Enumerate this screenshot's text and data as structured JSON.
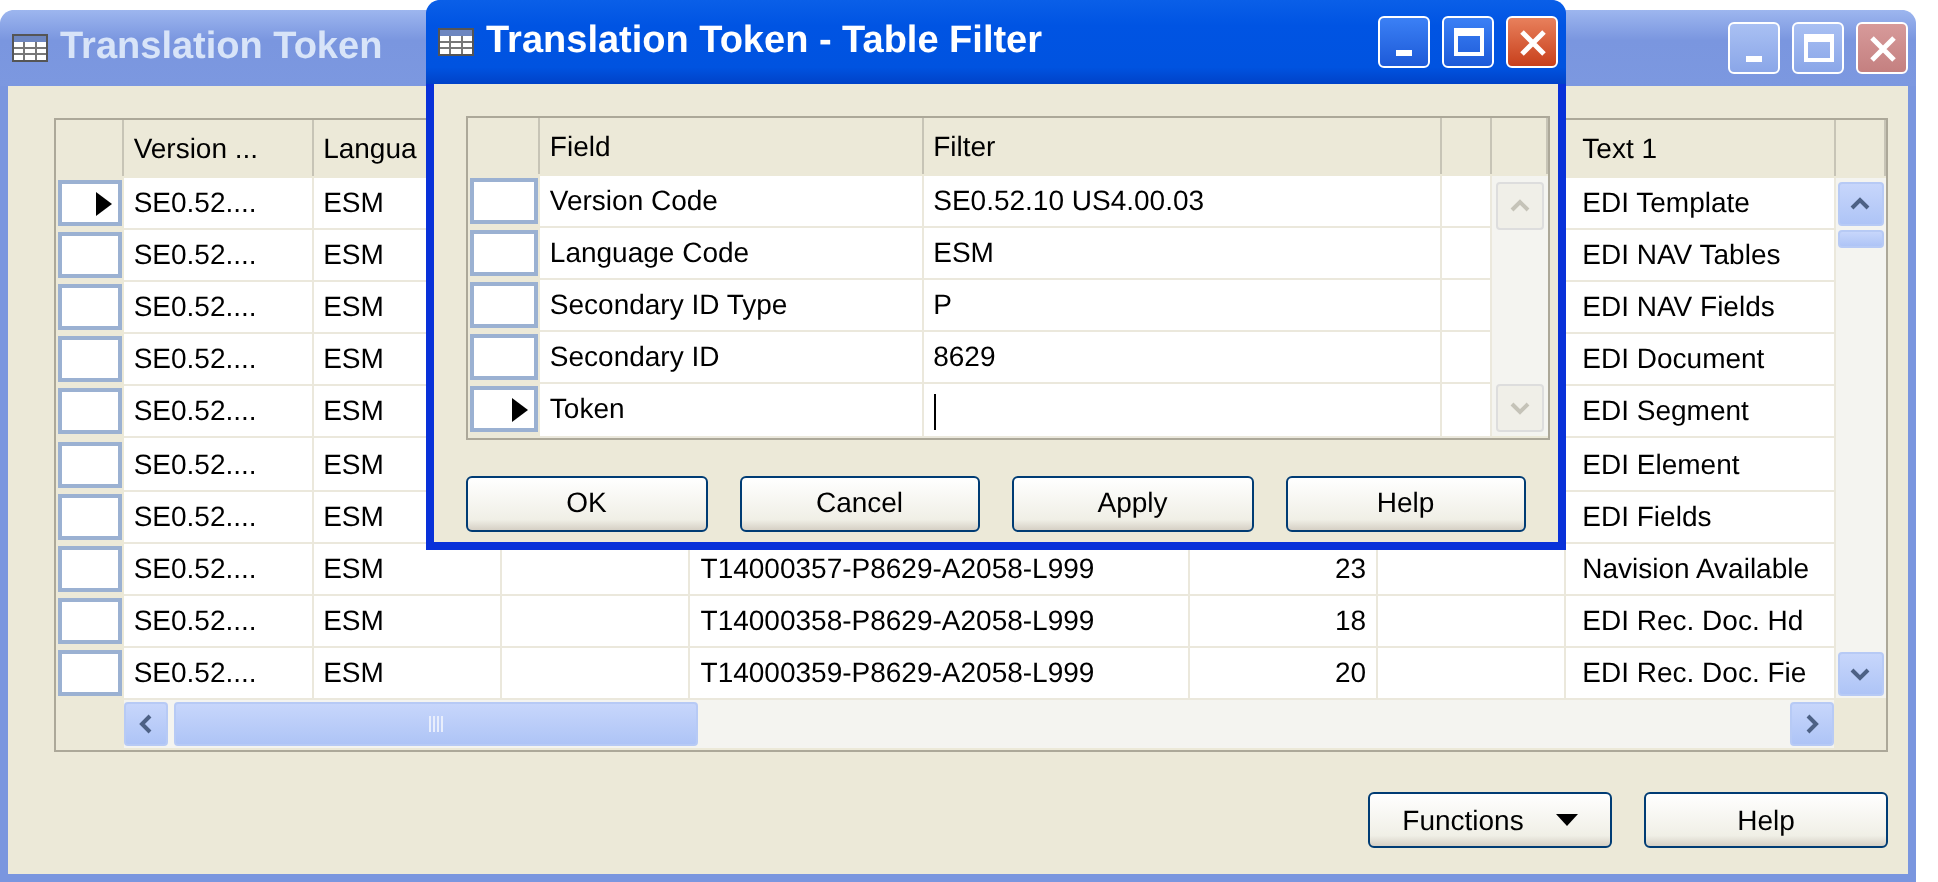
{
  "main_window": {
    "title": "Translation Token",
    "active": false,
    "column_headers": [
      "Version ...",
      "Langua",
      "Text 1"
    ],
    "rows": [
      {
        "current": true,
        "version": "SE0.52....",
        "language": "ESM",
        "text_1": "EDI Template"
      },
      {
        "current": false,
        "version": "SE0.52....",
        "language": "ESM",
        "text_1": "EDI NAV Tables"
      },
      {
        "current": false,
        "version": "SE0.52....",
        "language": "ESM",
        "text_1": "EDI NAV Fields"
      },
      {
        "current": false,
        "version": "SE0.52....",
        "language": "ESM",
        "text_1": "EDI Document"
      },
      {
        "current": false,
        "version": "SE0.52....",
        "language": "ESM",
        "text_1": "EDI Segment"
      },
      {
        "current": false,
        "version": "SE0.52....",
        "language": "ESM",
        "text_1": "EDI Element"
      },
      {
        "current": false,
        "version": "SE0.52....",
        "language": "ESM",
        "text_1": "EDI Fields"
      },
      {
        "current": false,
        "version": "SE0.52....",
        "language": "ESM",
        "column_4": "T14000357-P8629-A2058-L999",
        "column_5": "23",
        "text_1": "Navision Available"
      },
      {
        "current": false,
        "version": "SE0.52....",
        "language": "ESM",
        "column_4": "T14000358-P8629-A2058-L999",
        "column_5": "18",
        "text_1": "EDI Rec. Doc. Hd"
      },
      {
        "current": false,
        "version": "SE0.52....",
        "language": "ESM",
        "column_4": "T14000359-P8629-A2058-L999",
        "column_5": "20",
        "text_1": "EDI Rec. Doc. Fie"
      }
    ],
    "buttons": [
      {
        "label": "Functions",
        "dropdown": true
      },
      {
        "label": "Help",
        "dropdown": false
      }
    ]
  },
  "filter_dialog": {
    "title": "Translation Token - Table Filter",
    "active": true,
    "columns": [
      "Field",
      "Filter"
    ],
    "rows": [
      {
        "current": false,
        "editing": false,
        "field": "Version Code",
        "filter": "SE0.52.10 US4.00.03"
      },
      {
        "current": false,
        "editing": false,
        "field": "Language Code",
        "filter": "ESM"
      },
      {
        "current": false,
        "editing": false,
        "field": "Secondary ID Type",
        "filter": "P"
      },
      {
        "current": false,
        "editing": false,
        "field": "Secondary ID",
        "filter": "8629"
      },
      {
        "current": true,
        "editing": true,
        "field": "Token"
      }
    ],
    "buttons": [
      "OK",
      "Cancel",
      "Apply",
      "Help"
    ]
  }
}
